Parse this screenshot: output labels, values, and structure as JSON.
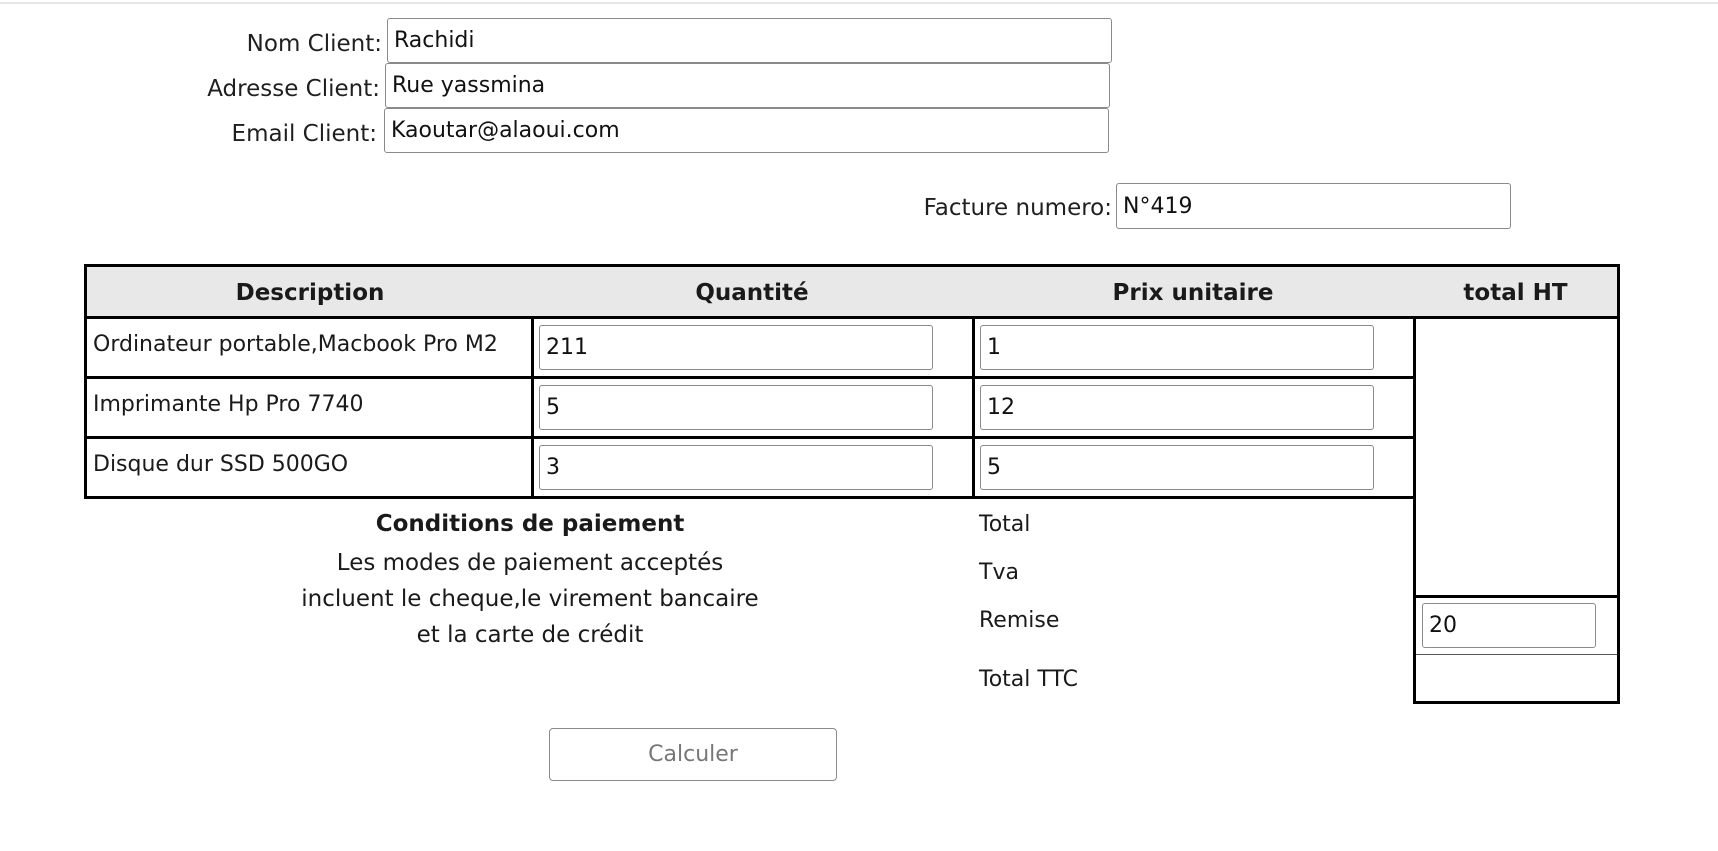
{
  "client": {
    "name_label": "Nom Client:",
    "name_value": "Rachidi",
    "address_label": "Adresse Client:",
    "address_value": "Rue yassmina",
    "email_label": "Email Client:",
    "email_value": "Kaoutar@alaoui.com"
  },
  "invoice": {
    "number_label": "Facture numero:",
    "number_value": "N°419"
  },
  "table": {
    "headers": [
      "Description",
      "Quantité",
      "Prix unitaire",
      "total HT"
    ],
    "rows": [
      {
        "description": "Ordinateur portable,Macbook Pro M2",
        "quantity": "211",
        "unit_price": "1"
      },
      {
        "description": "Imprimante Hp Pro 7740",
        "quantity": "5",
        "unit_price": "12"
      },
      {
        "description": "Disque dur SSD 500GO",
        "quantity": "3",
        "unit_price": "5"
      }
    ]
  },
  "payment": {
    "title": "Conditions de paiement",
    "text": "Les modes de paiement acceptés incluent le cheque,le virement bancaire et la carte de crédit"
  },
  "totals": {
    "total_label": "Total",
    "tva_label": "Tva",
    "remise_label": "Remise",
    "remise_value": "20",
    "total_ttc_label": "Total TTC"
  },
  "actions": {
    "calculate_label": "Calculer"
  }
}
